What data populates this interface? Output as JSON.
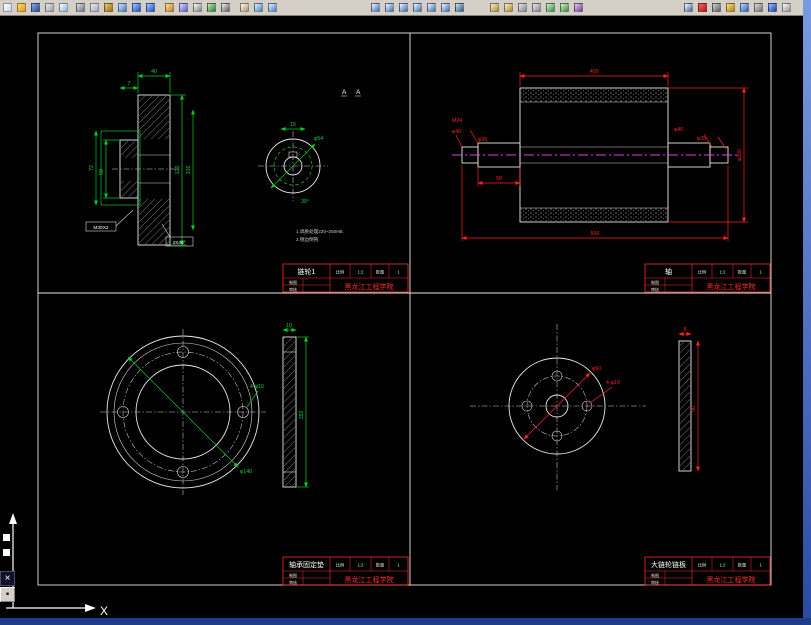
{
  "ucs": {
    "x_label": "X"
  },
  "side_buttons": [
    {
      "name": "pin-tool",
      "glyph": "×"
    },
    {
      "name": "mini-tool",
      "glyph": "▪"
    }
  ],
  "titleblock": {
    "school": "黑龙江工程学院",
    "scale_label": "比例",
    "scale_value": "1:2",
    "qty_label": "数量",
    "qty_value": "1",
    "draw_label": "制图",
    "check_label": "审核"
  },
  "sheets": {
    "sprocket": {
      "name": "链轮1",
      "dims": {
        "top_width": "40",
        "hub_t": "7",
        "left_h": "58",
        "left_h2": "72",
        "right_h": "120",
        "right_h2": "100",
        "thread": "M30X2",
        "chamfer": "2X45°",
        "circle_dia": "φ54",
        "circle_top": "15",
        "angle": "30°",
        "section": "A"
      },
      "notes": [
        "1.调质处理220~250HB.",
        "2.锐边倒钝."
      ]
    },
    "shaft": {
      "name": "轴",
      "dims": {
        "length": "400",
        "overall": "500",
        "drum_dia": "φ200",
        "left_d1": "M24",
        "left_d2": "φ40",
        "left_d3": "φ35",
        "right_d1": "φ40",
        "right_d2": "φ35",
        "left_len": "58"
      }
    },
    "flange": {
      "name": "轴承固定垫",
      "dims": {
        "outer_dia": "φ140",
        "holes": "4-φ10",
        "side_h": "150",
        "side_t": "10"
      }
    },
    "plate": {
      "name": "大链轮链板",
      "dims": {
        "bolt_dia": "φ60",
        "holes": "4-φ10",
        "side_t": "8",
        "side_h": "96"
      }
    }
  },
  "toolbar": {
    "groups": [
      {
        "name": "file",
        "icons": [
          {
            "name": "new-file",
            "c1": "#ffffff",
            "c2": "#c8d4e8"
          },
          {
            "name": "open-file",
            "c1": "#ffd76e",
            "c2": "#d8a018"
          },
          {
            "name": "save-file",
            "c1": "#8aa8e0",
            "c2": "#2a4a9a"
          },
          {
            "name": "print",
            "c1": "#e8e8e8",
            "c2": "#9aa0a8"
          },
          {
            "name": "print-preview",
            "c1": "#ffffff",
            "c2": "#8ab0d8"
          }
        ]
      },
      {
        "name": "edit",
        "icons": [
          {
            "name": "cut",
            "c1": "#e0e0e0",
            "c2": "#707880"
          },
          {
            "name": "copy",
            "c1": "#f0f0f0",
            "c2": "#a0a8b8"
          },
          {
            "name": "paste",
            "c1": "#e8c878",
            "c2": "#9a7018"
          },
          {
            "name": "match-properties",
            "c1": "#d0e8ff",
            "c2": "#4878b0"
          },
          {
            "name": "undo",
            "c1": "#a8c8ff",
            "c2": "#2050c0"
          },
          {
            "name": "redo",
            "c1": "#a8c8ff",
            "c2": "#2050c0"
          }
        ]
      },
      {
        "name": "draw",
        "icons": [
          {
            "name": "insert-block",
            "c1": "#ffe0a0",
            "c2": "#c08030"
          },
          {
            "name": "make-block",
            "c1": "#d8d8ff",
            "c2": "#6060c0"
          },
          {
            "name": "point",
            "c1": "#ffffff",
            "c2": "#808080"
          },
          {
            "name": "hatch",
            "c1": "#c0e8c0",
            "c2": "#308030"
          },
          {
            "name": "text",
            "c1": "#f0f0f0",
            "c2": "#606060"
          }
        ]
      },
      {
        "name": "view",
        "icons": [
          {
            "name": "pan",
            "c1": "#ffffff",
            "c2": "#b09060"
          },
          {
            "name": "zoom-realtime",
            "c1": "#e0f0ff",
            "c2": "#5080c0"
          },
          {
            "name": "zoom-window",
            "c1": "#e0f0ff",
            "c2": "#5080c0"
          }
        ]
      },
      {
        "name": "zoom",
        "icons": [
          {
            "name": "zoom-in",
            "c1": "#f0f8ff",
            "c2": "#4070b0"
          },
          {
            "name": "zoom-out",
            "c1": "#f0f8ff",
            "c2": "#4070b0"
          },
          {
            "name": "zoom-previous",
            "c1": "#f0f8ff",
            "c2": "#4070b0"
          },
          {
            "name": "zoom-extents",
            "c1": "#f0f8ff",
            "c2": "#4070b0"
          },
          {
            "name": "zoom-all",
            "c1": "#f0f8ff",
            "c2": "#4070b0"
          },
          {
            "name": "zoom-scale",
            "c1": "#f0f8ff",
            "c2": "#4070b0"
          },
          {
            "name": "aerial-view",
            "c1": "#d0e0f0",
            "c2": "#305888"
          }
        ]
      },
      {
        "name": "inquiry",
        "icons": [
          {
            "name": "distance",
            "c1": "#f8f0d0",
            "c2": "#a89030"
          },
          {
            "name": "area",
            "c1": "#f8f0d0",
            "c2": "#a89030"
          },
          {
            "name": "list",
            "c1": "#e8e8e8",
            "c2": "#808890"
          },
          {
            "name": "locate-point",
            "c1": "#e8e8e8",
            "c2": "#808890"
          },
          {
            "name": "redraw",
            "c1": "#d0f0d0",
            "c2": "#409040"
          },
          {
            "name": "regen",
            "c1": "#d0f0d0",
            "c2": "#409040"
          },
          {
            "name": "properties",
            "c1": "#e0d0f0",
            "c2": "#7040a0"
          }
        ]
      },
      {
        "name": "right",
        "icons": [
          {
            "name": "layer-control",
            "c1": "#ffffff",
            "c2": "#4060a0"
          },
          {
            "name": "color-control",
            "c1": "#ff6060",
            "c2": "#a02020"
          },
          {
            "name": "linetype-control",
            "c1": "#d0d0d0",
            "c2": "#606060"
          },
          {
            "name": "object-snap",
            "c1": "#ffe080",
            "c2": "#b08020"
          },
          {
            "name": "ucs-toggle",
            "c1": "#c0d8ff",
            "c2": "#3060b0"
          },
          {
            "name": "grid-toggle",
            "c1": "#e0e0e0",
            "c2": "#707070"
          },
          {
            "name": "help",
            "c1": "#a0c0ff",
            "c2": "#2040a0"
          },
          {
            "name": "about",
            "c1": "#ffffff",
            "c2": "#909090"
          }
        ]
      }
    ]
  }
}
